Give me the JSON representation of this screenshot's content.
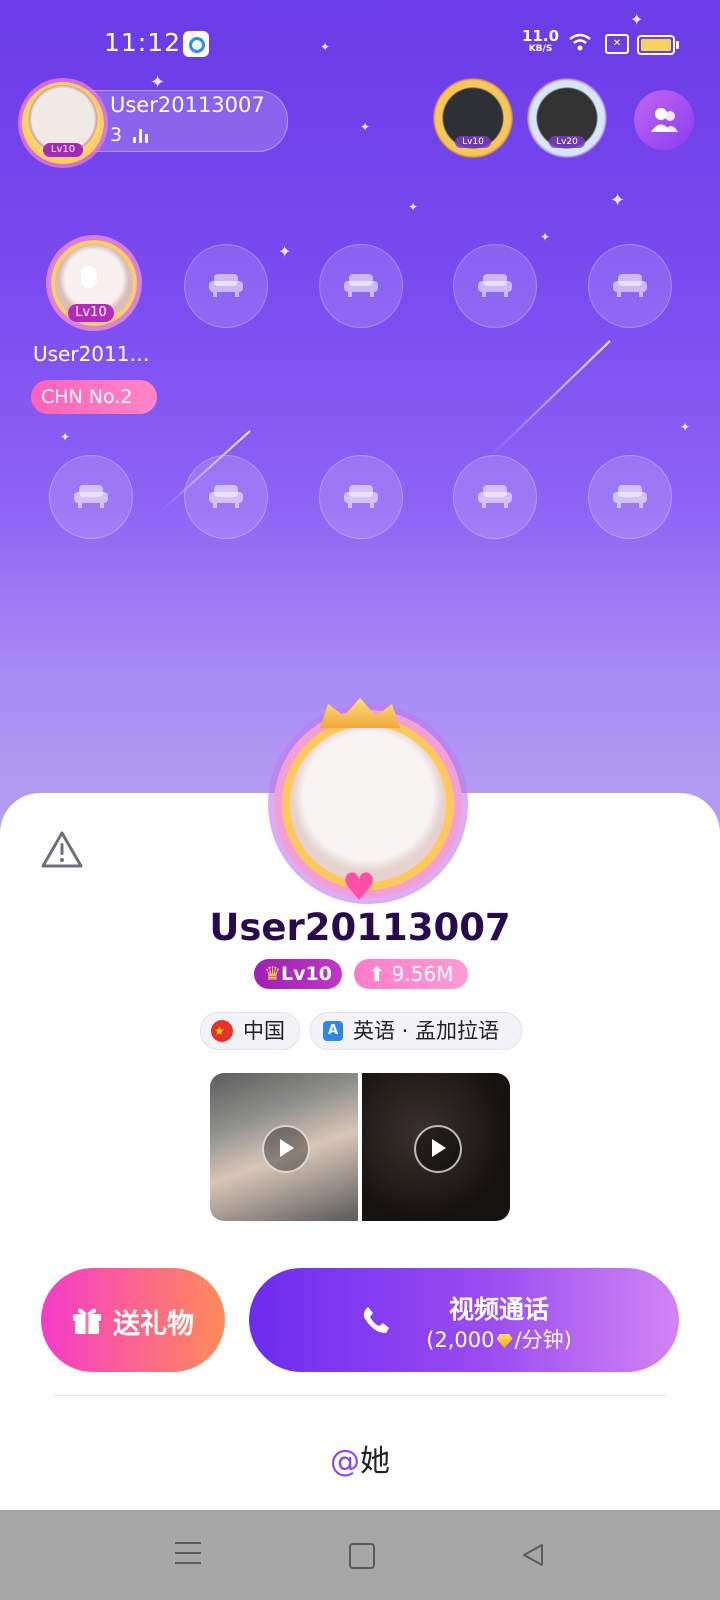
{
  "status_bar": {
    "time": "11:12",
    "net_speed": "11.0",
    "net_unit": "KB/S"
  },
  "room_host": {
    "name": "User20113007",
    "count": "3",
    "level": "Lv10"
  },
  "top_viewers": [
    {
      "level": "Lv10"
    },
    {
      "level": "Lv20"
    }
  ],
  "seat": {
    "name": "User2011…",
    "level": "Lv10",
    "rank": "CHN No.2"
  },
  "profile": {
    "name": "User20113007",
    "level": "Lv10",
    "wealth": "9.56M",
    "country": "中国",
    "languages": "英语 · 孟加拉语",
    "lang_icon": "A"
  },
  "actions": {
    "gift_label": "送礼物",
    "call_title": "视频通话",
    "call_price_prefix": "(2,000",
    "call_price_suffix": "/分钟)"
  },
  "mention": {
    "at": "@",
    "label": "她"
  },
  "colors": {
    "accent": "#8b44ef",
    "gift_start": "#f53bc9",
    "gift_end": "#ff8c58",
    "call_start": "#6c2cf0",
    "call_end": "#d384f4"
  },
  "icons": [
    "report-icon",
    "contacts-icon",
    "sofa-icon",
    "gift-icon",
    "phone-icon",
    "diamond-icon",
    "play-icon"
  ]
}
